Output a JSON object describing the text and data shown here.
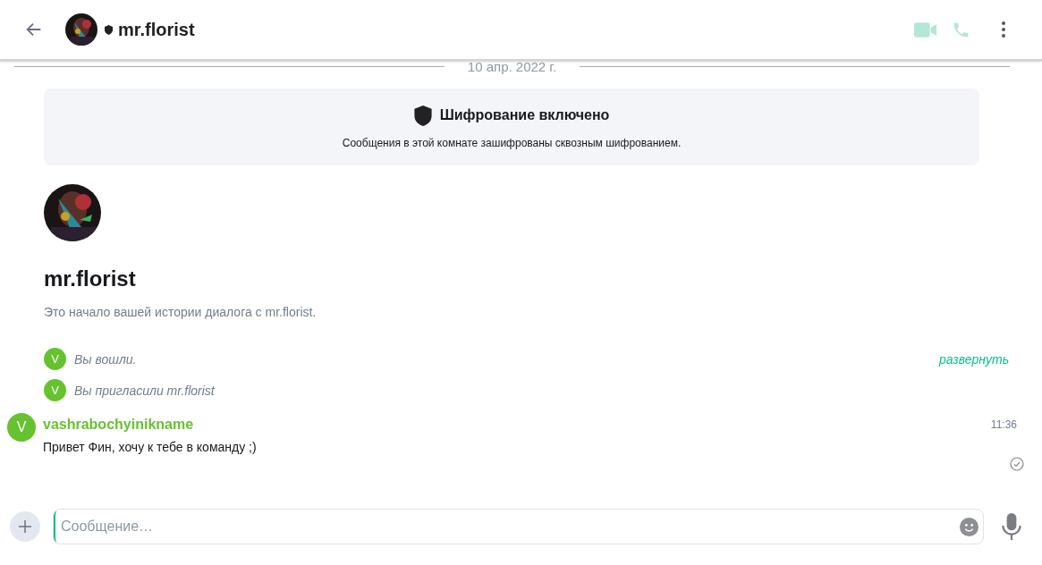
{
  "header": {
    "title": "mr.florist"
  },
  "date_divider": "10 апр. 2022 г.",
  "encryption_notice": {
    "title": "Шифрование включено",
    "text": "Сообщения в этой комнате зашифрованы сквозным шифрованием."
  },
  "room_intro": {
    "name": "mr.florist",
    "text": "Это начало вашей истории диалога с mr.florist."
  },
  "events": [
    {
      "avatar_letter": "V",
      "text": "Вы вошли."
    },
    {
      "avatar_letter": "V",
      "text": "Вы пригласили mr.florist"
    }
  ],
  "expand_link": "развернуть",
  "messages": [
    {
      "avatar_letter": "V",
      "sender": "vashrabochyinikname",
      "time": "11:36",
      "text": "Привет Фин, хочу к тебе в команду ;)",
      "read": true
    }
  ],
  "composer": {
    "placeholder": "Сообщение…"
  }
}
